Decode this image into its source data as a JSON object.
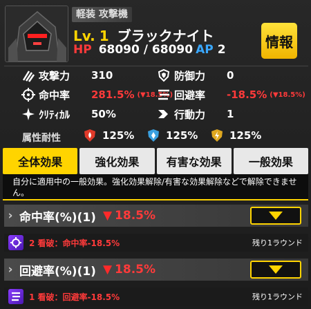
{
  "header": {
    "class_tag": "軽装 攻撃機",
    "level_label": "Lv.",
    "level": "1",
    "unit_name": "ブラックナイト",
    "hp_label": "HP",
    "hp_current": "68090",
    "hp_sep": "/",
    "hp_max": "68090",
    "ap_label": "AP",
    "ap_value": "2",
    "info_button": "情報"
  },
  "stats": {
    "attack": {
      "label": "攻撃力",
      "value": "310"
    },
    "defense": {
      "label": "防御力",
      "value": "0"
    },
    "accuracy": {
      "label": "命中率",
      "value": "281.5%",
      "sub": "(▼18.5%)"
    },
    "evasion": {
      "label": "回避率",
      "value": "-18.5%",
      "sub": "(▼18.5%)"
    },
    "critical": {
      "label": "ｸﾘﾃｨｶﾙ",
      "value": "50%"
    },
    "action": {
      "label": "行動力",
      "value": "1"
    }
  },
  "resistance": {
    "label": "属性耐性",
    "fire": "125%",
    "ice": "125%",
    "lightning": "125%"
  },
  "tabs": [
    "全体効果",
    "強化効果",
    "有害な効果",
    "一般効果"
  ],
  "description": "自分に適用中の一般効果。強化効果解除/有害な効果解除などで解除できません。",
  "effects": [
    {
      "title": "命中率(%)(1)",
      "triangle": "▼",
      "percent": "18.5%",
      "detail": "2 看破：命中率-18.5%",
      "remaining": "残り1ラウンド"
    },
    {
      "title": "回避率(%)(1)",
      "triangle": "▼",
      "percent": "18.5%",
      "detail": "1 看破：回避率-18.5%",
      "remaining": "残り1ラウンド"
    }
  ],
  "colors": {
    "accent": "#ffd400",
    "negative": "#ff3a3a",
    "ap": "#3aa8ff"
  }
}
